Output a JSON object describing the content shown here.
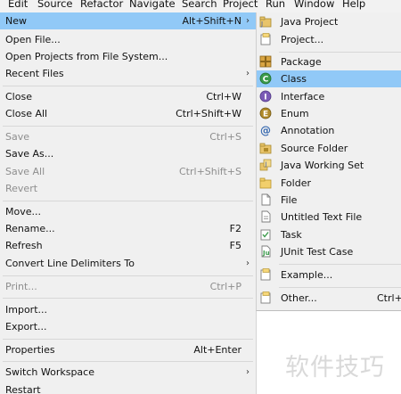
{
  "menubar": {
    "items": [
      "Edit",
      "Source",
      "Refactor",
      "Navigate",
      "Search",
      "Project",
      "Run",
      "Window",
      "Help"
    ]
  },
  "file_menu": {
    "items": [
      {
        "label": "New",
        "shortcut": "Alt+Shift+N",
        "arrow": "›",
        "highlighted": true
      },
      {
        "label": "Open File...",
        "shortcut": ""
      },
      {
        "label": "Open Projects from File System...",
        "shortcut": ""
      },
      {
        "label": "Recent Files",
        "shortcut": "",
        "arrow": "›"
      },
      {
        "label": "Close",
        "shortcut": "Ctrl+W"
      },
      {
        "label": "Close All",
        "shortcut": "Ctrl+Shift+W"
      },
      {
        "label": "Save",
        "shortcut": "Ctrl+S",
        "disabled": true
      },
      {
        "label": "Save As...",
        "shortcut": ""
      },
      {
        "label": "Save All",
        "shortcut": "Ctrl+Shift+S",
        "disabled": true
      },
      {
        "label": "Revert",
        "shortcut": "",
        "disabled": true
      },
      {
        "label": "Move...",
        "shortcut": ""
      },
      {
        "label": "Rename...",
        "shortcut": "F2"
      },
      {
        "label": "Refresh",
        "shortcut": "F5"
      },
      {
        "label": "Convert Line Delimiters To",
        "shortcut": "",
        "arrow": "›"
      },
      {
        "label": "Print...",
        "shortcut": "Ctrl+P",
        "disabled": true
      },
      {
        "label": "Import...",
        "shortcut": ""
      },
      {
        "label": "Export...",
        "shortcut": ""
      },
      {
        "label": "Properties",
        "shortcut": "Alt+Enter"
      },
      {
        "label": "Switch Workspace",
        "shortcut": "",
        "arrow": "›"
      },
      {
        "label": "Restart",
        "shortcut": ""
      }
    ]
  },
  "new_submenu": {
    "items": [
      {
        "label": "Java Project",
        "icon": "java-project-icon"
      },
      {
        "label": "Project...",
        "icon": "project-icon"
      },
      {
        "label": "Package",
        "icon": "package-icon"
      },
      {
        "label": "Class",
        "icon": "class-icon",
        "highlighted": true
      },
      {
        "label": "Interface",
        "icon": "interface-icon"
      },
      {
        "label": "Enum",
        "icon": "enum-icon"
      },
      {
        "label": "Annotation",
        "icon": "annotation-icon"
      },
      {
        "label": "Source Folder",
        "icon": "source-folder-icon"
      },
      {
        "label": "Java Working Set",
        "icon": "working-set-icon"
      },
      {
        "label": "Folder",
        "icon": "folder-icon"
      },
      {
        "label": "File",
        "icon": "file-icon"
      },
      {
        "label": "Untitled Text File",
        "icon": "text-file-icon"
      },
      {
        "label": "Task",
        "icon": "task-icon"
      },
      {
        "label": "JUnit Test Case",
        "icon": "junit-icon"
      },
      {
        "label": "Example...",
        "icon": "example-icon"
      },
      {
        "label": "Other...",
        "icon": "other-icon",
        "shortcut": "Ctrl+N"
      }
    ]
  },
  "watermark": {
    "text": "软件技巧"
  },
  "colors": {
    "highlight": "#91c9f7",
    "menu_bg": "#f0f0f0",
    "disabled_text": "#8e8e8e"
  }
}
